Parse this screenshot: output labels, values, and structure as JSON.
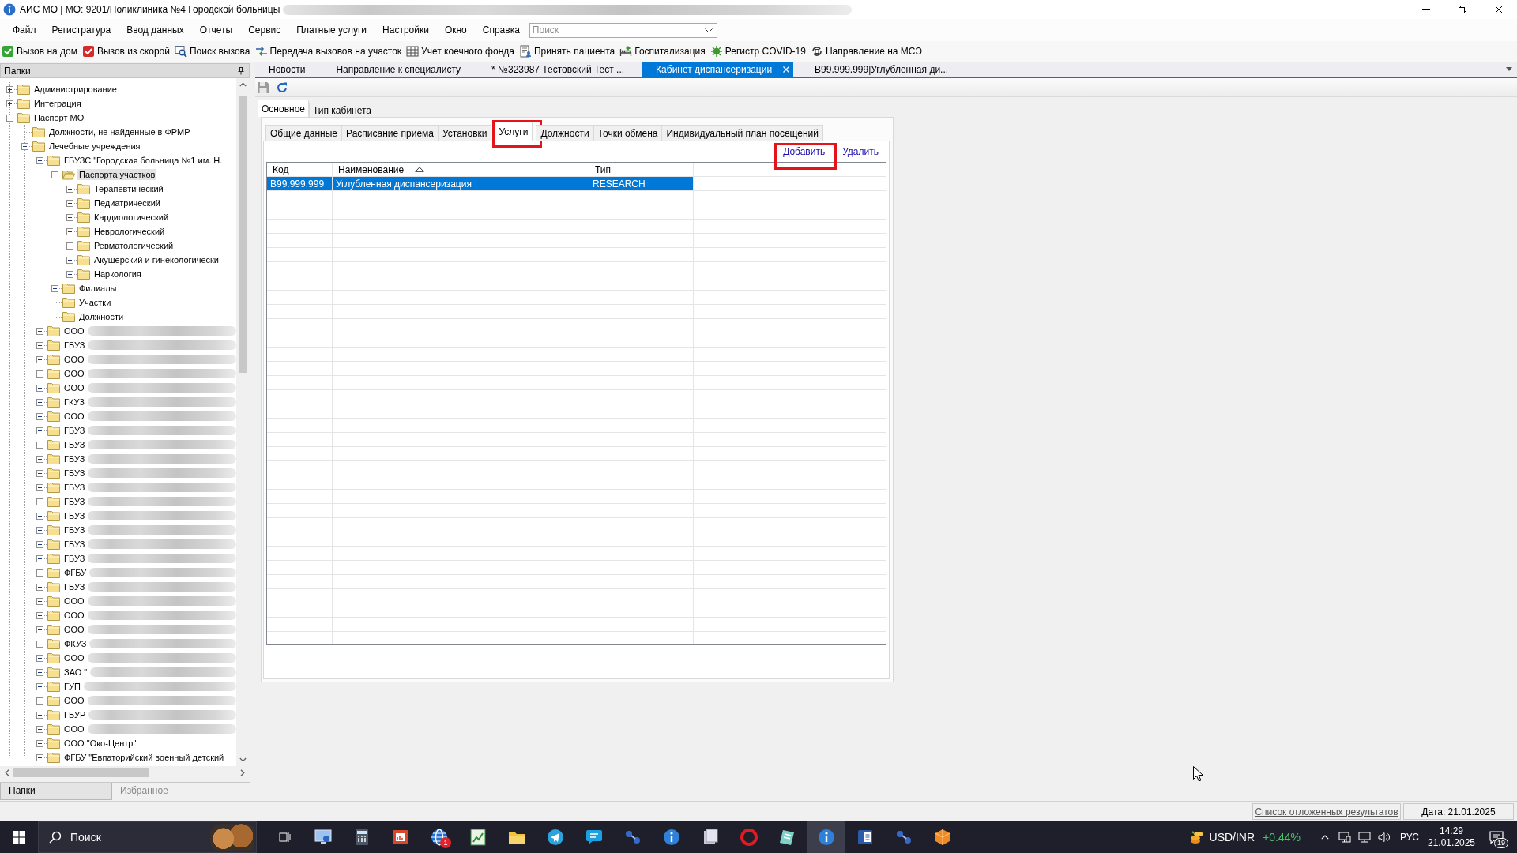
{
  "window": {
    "title": "АИС МО | МО: 9201/Поликлиника №4 Городской больницы",
    "redacted": true
  },
  "menu": [
    "Файл",
    "Регистратура",
    "Ввод данных",
    "Отчеты",
    "Сервис",
    "Платные услуги",
    "Настройки",
    "Окно",
    "Справка"
  ],
  "search": {
    "placeholder": "Поиск"
  },
  "toolbar": [
    "Вызов на дом",
    "Вызов из скорой",
    "Поиск вызова",
    "Передача вызовов на участок",
    "Учет коечного фонда",
    "Принять пациента",
    "Госпитализация",
    "Регистр COVID-19",
    "Направление на МСЭ"
  ],
  "folders": {
    "title": "Папки",
    "tree": [
      {
        "label": "Администрирование",
        "kind": "branch",
        "expanded": false,
        "selected": false,
        "redacted": false
      },
      {
        "label": "Интеграция",
        "kind": "branch",
        "expanded": false,
        "selected": false,
        "redacted": false
      },
      {
        "label": "Паспорт МО",
        "kind": "branch",
        "expanded": true,
        "selected": false,
        "redacted": false,
        "children": [
          {
            "label": "Должности, не найденные в ФРМР",
            "kind": "leaf",
            "expanded": false,
            "selected": false,
            "redacted": false
          },
          {
            "label": "Лечебные учреждения",
            "kind": "branch",
            "expanded": true,
            "selected": false,
            "redacted": false,
            "children": [
              {
                "label": "ГБУЗС \"Городская больница №1 им. Н.",
                "kind": "branch",
                "expanded": true,
                "selected": false,
                "redacted": false,
                "children": [
                  {
                    "label": "Паспорта участков",
                    "kind": "branch",
                    "expanded": true,
                    "selected": true,
                    "redacted": false,
                    "children": [
                      {
                        "label": "Терапевтический",
                        "kind": "branch",
                        "expanded": false,
                        "selected": false,
                        "redacted": false
                      },
                      {
                        "label": "Педиатрический",
                        "kind": "branch",
                        "expanded": false,
                        "selected": false,
                        "redacted": false
                      },
                      {
                        "label": "Кардиологический",
                        "kind": "branch",
                        "expanded": false,
                        "selected": false,
                        "redacted": false
                      },
                      {
                        "label": "Неврологический",
                        "kind": "branch",
                        "expanded": false,
                        "selected": false,
                        "redacted": false
                      },
                      {
                        "label": "Ревматологический",
                        "kind": "branch",
                        "expanded": false,
                        "selected": false,
                        "redacted": false
                      },
                      {
                        "label": "Акушерский и гинекологически",
                        "kind": "branch",
                        "expanded": false,
                        "selected": false,
                        "redacted": false
                      },
                      {
                        "label": "Наркология",
                        "kind": "branch",
                        "expanded": false,
                        "selected": false,
                        "redacted": false
                      }
                    ]
                  },
                  {
                    "label": "Филиалы",
                    "kind": "branch",
                    "expanded": false,
                    "selected": false,
                    "redacted": false
                  },
                  {
                    "label": "Участки",
                    "kind": "leaf",
                    "expanded": false,
                    "selected": false,
                    "redacted": false
                  },
                  {
                    "label": "Должности",
                    "kind": "leaf",
                    "expanded": false,
                    "selected": false,
                    "redacted": false
                  }
                ]
              },
              {
                "label": "ООО",
                "kind": "branch",
                "expanded": false,
                "selected": false,
                "redacted": true
              },
              {
                "label": "ГБУЗ",
                "kind": "branch",
                "expanded": false,
                "selected": false,
                "redacted": true
              },
              {
                "label": "ООО",
                "kind": "branch",
                "expanded": false,
                "selected": false,
                "redacted": true
              },
              {
                "label": "ООО",
                "kind": "branch",
                "expanded": false,
                "selected": false,
                "redacted": true
              },
              {
                "label": "ООО",
                "kind": "branch",
                "expanded": false,
                "selected": false,
                "redacted": true
              },
              {
                "label": "ГКУЗ",
                "kind": "branch",
                "expanded": false,
                "selected": false,
                "redacted": true
              },
              {
                "label": "ООО",
                "kind": "branch",
                "expanded": false,
                "selected": false,
                "redacted": true
              },
              {
                "label": "ГБУЗ",
                "kind": "branch",
                "expanded": false,
                "selected": false,
                "redacted": true
              },
              {
                "label": "ГБУЗ",
                "kind": "branch",
                "expanded": false,
                "selected": false,
                "redacted": true
              },
              {
                "label": "ГБУЗ",
                "kind": "branch",
                "expanded": false,
                "selected": false,
                "redacted": true
              },
              {
                "label": "ГБУЗ",
                "kind": "branch",
                "expanded": false,
                "selected": false,
                "redacted": true
              },
              {
                "label": "ГБУЗ",
                "kind": "branch",
                "expanded": false,
                "selected": false,
                "redacted": true
              },
              {
                "label": "ГБУЗ",
                "kind": "branch",
                "expanded": false,
                "selected": false,
                "redacted": true
              },
              {
                "label": "ГБУЗ",
                "kind": "branch",
                "expanded": false,
                "selected": false,
                "redacted": true
              },
              {
                "label": "ГБУЗ",
                "kind": "branch",
                "expanded": false,
                "selected": false,
                "redacted": true
              },
              {
                "label": "ГБУЗ",
                "kind": "branch",
                "expanded": false,
                "selected": false,
                "redacted": true
              },
              {
                "label": "ГБУЗ",
                "kind": "branch",
                "expanded": false,
                "selected": false,
                "redacted": true
              },
              {
                "label": "ФГБУ",
                "kind": "branch",
                "expanded": false,
                "selected": false,
                "redacted": true
              },
              {
                "label": "ГБУЗ",
                "kind": "branch",
                "expanded": false,
                "selected": false,
                "redacted": true
              },
              {
                "label": "ООО",
                "kind": "branch",
                "expanded": false,
                "selected": false,
                "redacted": true
              },
              {
                "label": "ООО",
                "kind": "branch",
                "expanded": false,
                "selected": false,
                "redacted": true
              },
              {
                "label": "ООО",
                "kind": "branch",
                "expanded": false,
                "selected": false,
                "redacted": true
              },
              {
                "label": "ФКУЗ",
                "kind": "branch",
                "expanded": false,
                "selected": false,
                "redacted": true
              },
              {
                "label": "ООО",
                "kind": "branch",
                "expanded": false,
                "selected": false,
                "redacted": true
              },
              {
                "label": "ЗАО \"",
                "kind": "branch",
                "expanded": false,
                "selected": false,
                "redacted": true
              },
              {
                "label": "ГУП",
                "kind": "branch",
                "expanded": false,
                "selected": false,
                "redacted": true
              },
              {
                "label": "ООО",
                "kind": "branch",
                "expanded": false,
                "selected": false,
                "redacted": true
              },
              {
                "label": "ГБУР",
                "kind": "branch",
                "expanded": false,
                "selected": false,
                "redacted": true
              },
              {
                "label": "ООО",
                "kind": "branch",
                "expanded": false,
                "selected": false,
                "redacted": true
              },
              {
                "label": "ООО \"Око-Центр\"",
                "kind": "branch",
                "expanded": false,
                "selected": false,
                "redacted": false
              },
              {
                "label": "ФГБУ \"Евпаторийский военный детский",
                "kind": "branch",
                "expanded": false,
                "selected": false,
                "redacted": false
              }
            ]
          }
        ]
      }
    ],
    "tabs": [
      {
        "label": "Папки",
        "selected": true
      },
      {
        "label": "Избранное",
        "selected": false
      }
    ]
  },
  "documents": {
    "tabs": [
      {
        "label": "Новости",
        "selected": false
      },
      {
        "label": "Направление к специалисту",
        "selected": false
      },
      {
        "label": "* №323987 Тестовский Тест ...",
        "selected": false
      },
      {
        "label": "Кабинет диспансеризации",
        "selected": true
      },
      {
        "label": "B99.999.999|Углубленная ди...",
        "selected": false
      }
    ]
  },
  "content": {
    "tabs": [
      {
        "label": "Основное",
        "selected": true
      },
      {
        "label": "Тип кабинета",
        "selected": false
      }
    ],
    "subtabs": [
      {
        "label": "Общие данные",
        "selected": false,
        "highlighted": false
      },
      {
        "label": "Расписание приема",
        "selected": false,
        "highlighted": false
      },
      {
        "label": "Установки",
        "selected": false,
        "highlighted": false
      },
      {
        "label": "Услуги",
        "selected": true,
        "highlighted": true
      },
      {
        "label": "Должности",
        "selected": false,
        "highlighted": false
      },
      {
        "label": "Точки обмена",
        "selected": false,
        "highlighted": false
      },
      {
        "label": "Индивидуальный план посещений",
        "selected": false,
        "highlighted": false
      }
    ],
    "actions": [
      {
        "label": "Добавить",
        "highlighted": true
      },
      {
        "label": "Удалить",
        "highlighted": false
      }
    ],
    "table": {
      "columns": [
        {
          "label": "Код",
          "sorted": false
        },
        {
          "label": "Наименование",
          "sorted": true
        },
        {
          "label": "Тип",
          "sorted": false
        }
      ],
      "rows": [
        {
          "cells": [
            "B99.999.999",
            "Углубленная диспансеризация",
            "RESEARCH"
          ],
          "selected": true
        }
      ]
    }
  },
  "status_bar": {
    "link": "Список отложенных результатов",
    "date": "Дата: 21.01.2025"
  },
  "taskbar": {
    "search_placeholder": "Поиск",
    "apps": [
      {
        "selected": false
      },
      {
        "selected": false
      },
      {
        "selected": false
      },
      {
        "selected": false,
        "badge": "1"
      },
      {
        "selected": false
      },
      {
        "selected": false
      },
      {
        "selected": false
      },
      {
        "selected": false
      },
      {
        "selected": false
      },
      {
        "selected": false
      },
      {
        "selected": false
      },
      {
        "selected": false
      },
      {
        "selected": false
      },
      {
        "selected": true
      },
      {
        "selected": false
      },
      {
        "selected": false
      },
      {
        "selected": false
      }
    ],
    "ticker": {
      "symbol": "USD/INR",
      "change": "+0.44%"
    },
    "language": "РУС",
    "time": "14:29",
    "date": "21.01.2025",
    "notifications": "19"
  }
}
